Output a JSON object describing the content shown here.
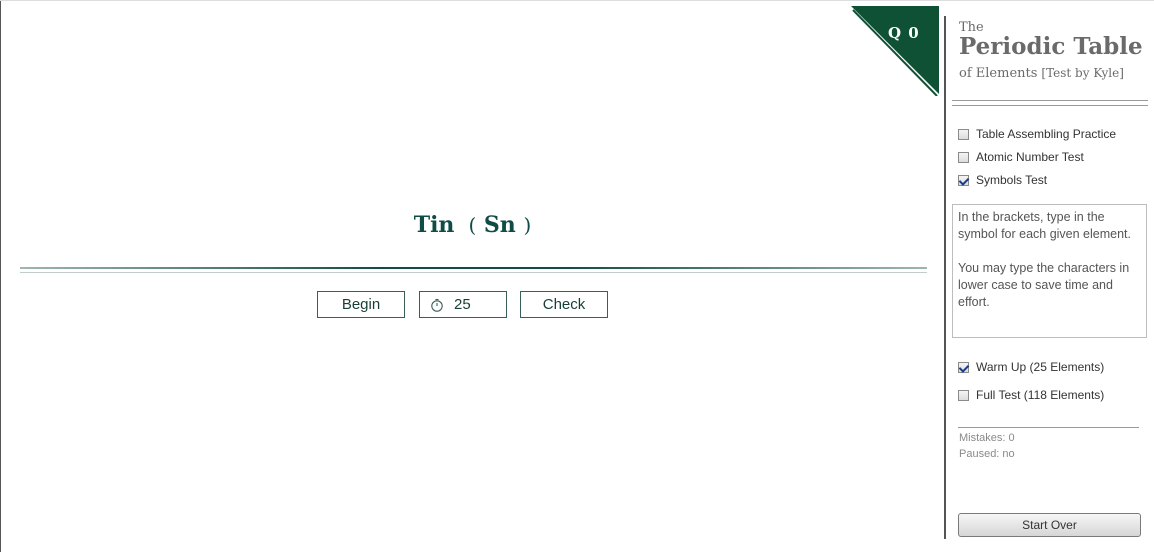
{
  "badge": {
    "label": "Q 0",
    "color": "#0f5135"
  },
  "prompt": {
    "element": "Tin",
    "open": "(",
    "symbol": "Sn",
    "close": ")"
  },
  "controls": {
    "begin_label": "Begin",
    "timer_value": "25",
    "timer_icon": "stopwatch-icon",
    "check_label": "Check"
  },
  "title": {
    "the": "The",
    "main": "Periodic Table",
    "sub": "of Elements",
    "by": "[Test by Kyle]"
  },
  "modes": [
    {
      "label": "Table Assembling Practice",
      "checked": false
    },
    {
      "label": "Atomic Number Test",
      "checked": false
    },
    {
      "label": "Symbols Test",
      "checked": true
    }
  ],
  "instructions": {
    "line1": "In the brackets, type in the symbol for each given element.",
    "line2": "You may type the characters in lower case to save time and effort."
  },
  "scope": [
    {
      "label": "Warm Up (25 Elements)",
      "checked": true
    },
    {
      "label": "Full Test (118 Elements)",
      "checked": false
    }
  ],
  "stats": {
    "mistakes": "Mistakes: 0",
    "paused": "Paused: no"
  },
  "start_over_label": "Start Over",
  "colors": {
    "accent": "#0f4c45",
    "badge": "#0f5135"
  }
}
